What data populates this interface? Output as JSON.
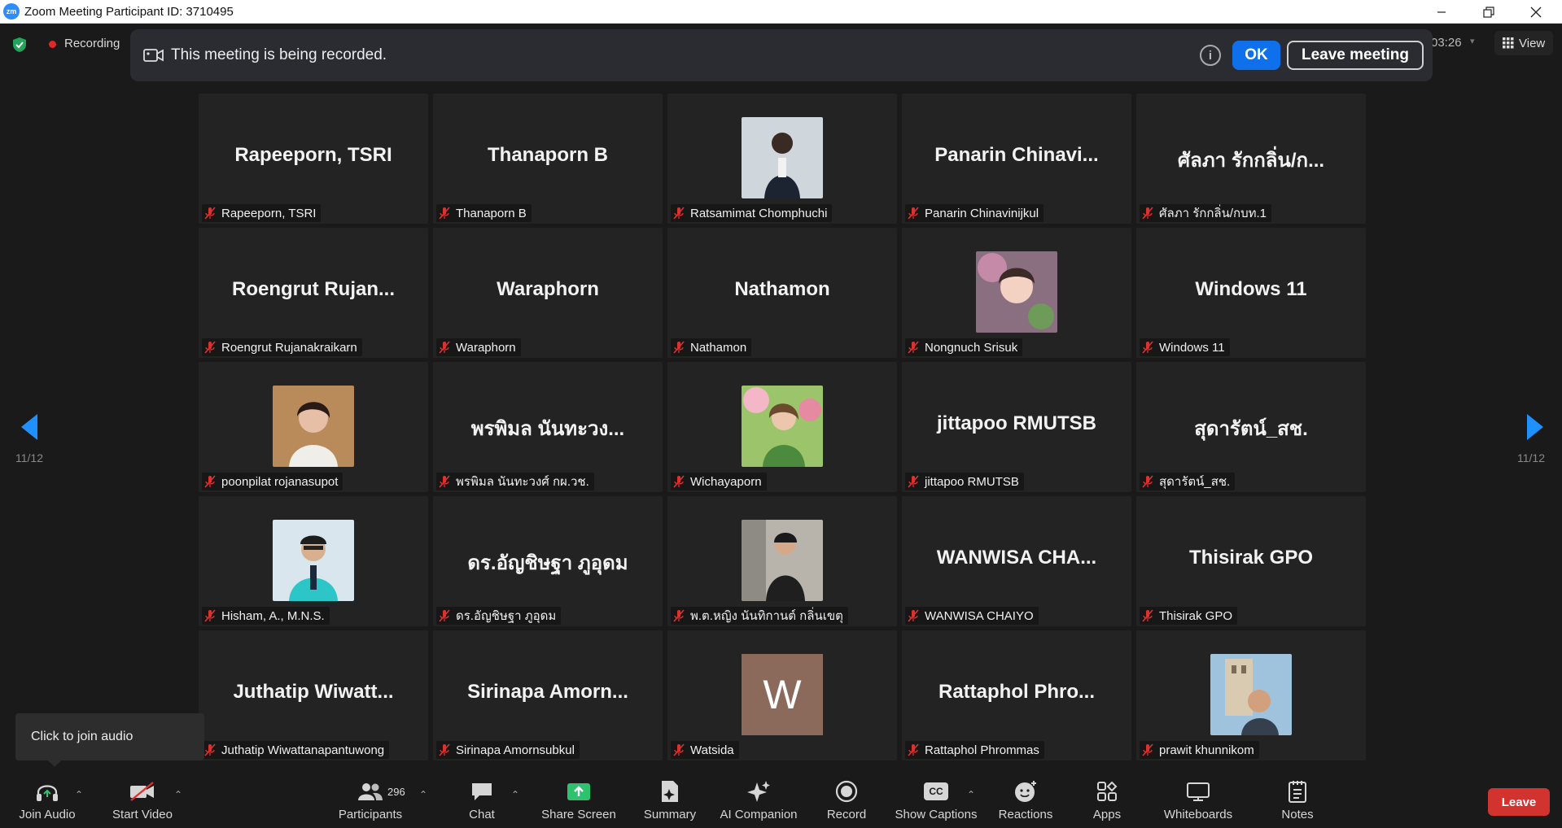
{
  "window": {
    "title": "Zoom Meeting Participant ID: 3710495",
    "logo_text": "zm"
  },
  "status": {
    "recording_label": "Recording",
    "timer": "03:26",
    "view_label": "View"
  },
  "banner": {
    "message": "This meeting is being recorded.",
    "ok_label": "OK",
    "leave_meeting_label": "Leave meeting"
  },
  "pager": {
    "left_indicator": "11/12",
    "right_indicator": "11/12"
  },
  "tiles": [
    {
      "display": "Rapeeporn, TSRI",
      "name": "Rapeeporn, TSRI"
    },
    {
      "display": "Thanaporn B",
      "name": "Thanaporn B"
    },
    {
      "display": "",
      "name": "Ratsamimat Chomphuchi"
    },
    {
      "display": "Panarin  Chinavi...",
      "name": "Panarin Chinavinijkul"
    },
    {
      "display": "ศัลภา  รักกลิ่น/ก...",
      "name": "ศัลภา  รักกลิ่น/กบท.1"
    },
    {
      "display": "Roengrut Rujan...",
      "name": "Roengrut Rujanakraikarn"
    },
    {
      "display": "Waraphorn",
      "name": "Waraphorn"
    },
    {
      "display": "Nathamon",
      "name": "Nathamon"
    },
    {
      "display": "",
      "name": "Nongnuch Srisuk"
    },
    {
      "display": "Windows 11",
      "name": "Windows 11"
    },
    {
      "display": "",
      "name": "poonpilat rojanasupot"
    },
    {
      "display": "พรพิมล นันทะวง...",
      "name": "พรพิมล นันทะวงศ์ กผ.วช."
    },
    {
      "display": "",
      "name": "Wichayaporn"
    },
    {
      "display": "jittapoo RMUTSB",
      "name": "jittapoo RMUTSB"
    },
    {
      "display": "สุดารัตน์_สช.",
      "name": "สุดารัตน์_สช."
    },
    {
      "display": "",
      "name": "Hisham, A., M.N.S."
    },
    {
      "display": "ดร.อัญชิษฐา ภูอุดม",
      "name": "ดร.อัญชิษฐา ภูอุดม"
    },
    {
      "display": "",
      "name": "พ.ต.หญิง นันทิกานต์ กลิ่นเขตุ"
    },
    {
      "display": "WANWISA  CHA...",
      "name": "WANWISA CHAIYO"
    },
    {
      "display": "Thisirak GPO",
      "name": "Thisirak GPO"
    },
    {
      "display": "Juthatip  Wiwatt...",
      "name": "Juthatip Wiwattanapantuwong"
    },
    {
      "display": "Sirinapa  Amorn...",
      "name": "Sirinapa Amornsubkul"
    },
    {
      "display": "W",
      "name": "Watsida"
    },
    {
      "display": "Rattaphol  Phro...",
      "name": "Rattaphol Phrommas"
    },
    {
      "display": "",
      "name": "prawit khunnikom"
    }
  ],
  "tooltip": {
    "text": "Click to join audio"
  },
  "toolbar": {
    "join_audio": "Join Audio",
    "start_video": "Start Video",
    "participants": "Participants",
    "participant_count": "296",
    "chat": "Chat",
    "share_screen": "Share Screen",
    "summary": "Summary",
    "ai_companion": "AI Companion",
    "record": "Record",
    "show_captions": "Show Captions",
    "cc_glyph": "CC",
    "reactions": "Reactions",
    "apps": "Apps",
    "whiteboards": "Whiteboards",
    "notes": "Notes",
    "leave": "Leave"
  },
  "colors": {
    "accent_blue": "#0e71eb",
    "share_green": "#2ec26f",
    "leave_red": "#d2332f",
    "muted_red": "#e0302e",
    "tile_bg": "#232323"
  }
}
